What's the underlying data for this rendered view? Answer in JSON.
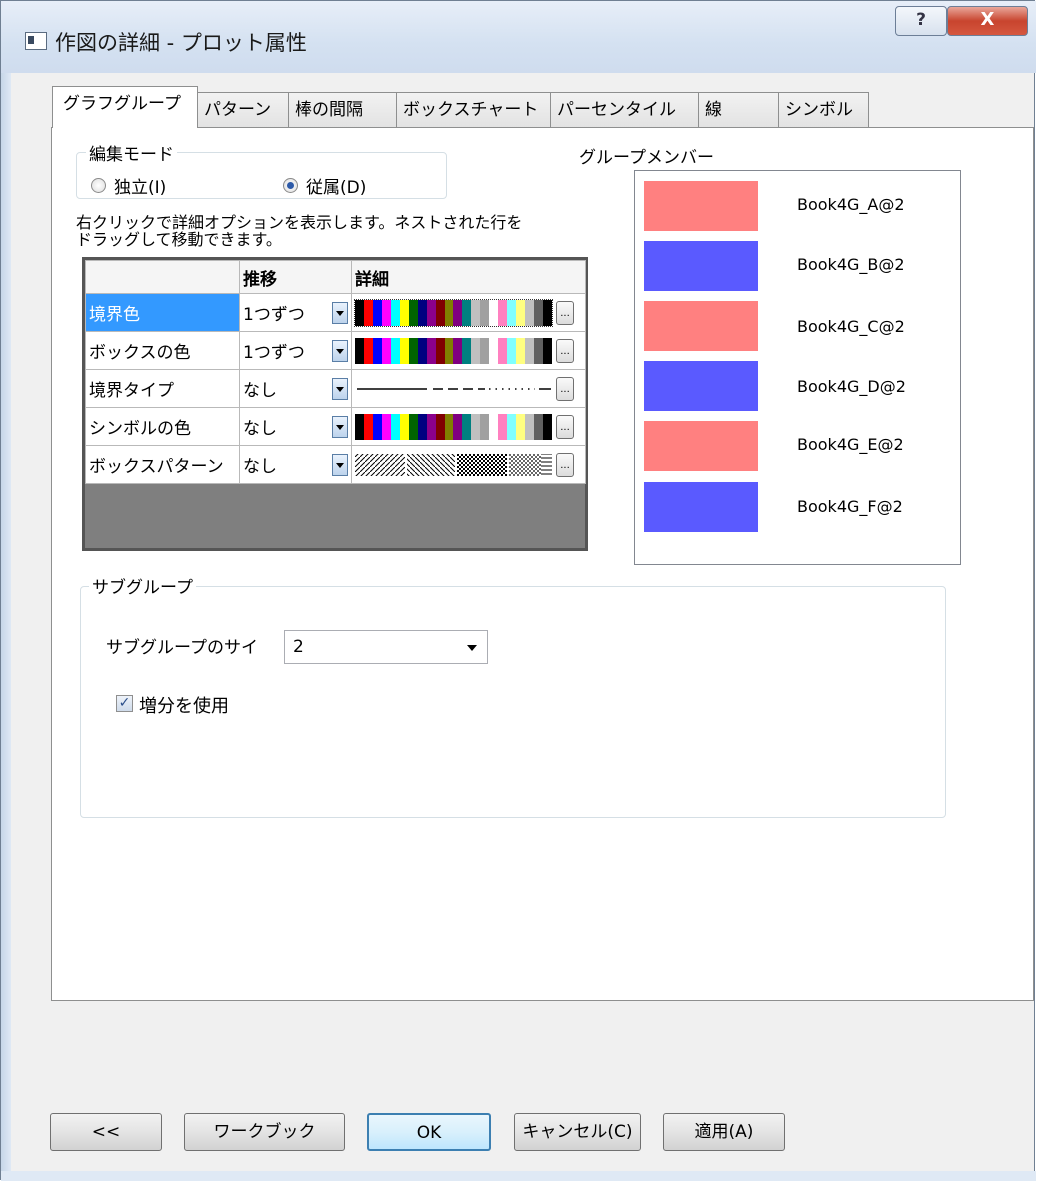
{
  "window": {
    "title": "作図の詳細 - プロット属性",
    "help_label": "?",
    "close_label": "X"
  },
  "tabs": [
    {
      "label": "グラフグループ",
      "active": true
    },
    {
      "label": "パターン",
      "active": false
    },
    {
      "label": "棒の間隔",
      "active": false
    },
    {
      "label": "ボックスチャート",
      "active": false
    },
    {
      "label": "パーセンタイル",
      "active": false
    },
    {
      "label": "線",
      "active": false
    },
    {
      "label": "シンボル",
      "active": false
    }
  ],
  "edit_mode": {
    "title": "編集モード",
    "independent_label": "独立(I)",
    "dependent_label": "従属(D)",
    "selected": "dependent"
  },
  "hint_text": "右クリックで詳細オプションを表示します。ネストされた行をドラッグして移動できます。",
  "grid": {
    "headers": [
      "",
      "推移",
      "詳細"
    ],
    "rows": [
      {
        "name": "境界色",
        "mode": "1つずつ",
        "detail": "colors",
        "selected": true
      },
      {
        "name": "ボックスの色",
        "mode": "1つずつ",
        "detail": "colors",
        "selected": false
      },
      {
        "name": "境界タイプ",
        "mode": "なし",
        "detail": "lines",
        "selected": false
      },
      {
        "name": "シンボルの色",
        "mode": "なし",
        "detail": "colors",
        "selected": false
      },
      {
        "name": "ボックスパターン",
        "mode": "なし",
        "detail": "patterns",
        "selected": false
      }
    ]
  },
  "color_strip": [
    "#000000",
    "#ff0000",
    "#0000ff",
    "#ff00ff",
    "#00ffff",
    "#ffff00",
    "#006400",
    "#000080",
    "#8b008b",
    "#800000",
    "#808000",
    "#800080",
    "#008080",
    "#c0c0c0",
    "#a0a0a0",
    "#ffffff",
    "#ff80c0",
    "#80ffff",
    "#ffff80",
    "#c0c0c0",
    "#606060",
    "#000000"
  ],
  "members": {
    "title": "グループメンバー",
    "items": [
      {
        "label": "Book4G_A@2",
        "color": "#ff8080"
      },
      {
        "label": "Book4G_B@2",
        "color": "#5a5aff"
      },
      {
        "label": "Book4G_C@2",
        "color": "#ff8080"
      },
      {
        "label": "Book4G_D@2",
        "color": "#5a5aff"
      },
      {
        "label": "Book4G_E@2",
        "color": "#ff8080"
      },
      {
        "label": "Book4G_F@2",
        "color": "#5a5aff"
      }
    ]
  },
  "subgroup": {
    "title": "サブグループ",
    "size_label": "サブグループのサイ",
    "size_value": "2",
    "use_increment_label": "増分を使用",
    "use_increment_checked": true
  },
  "buttons": {
    "back": "<<",
    "workbook": "ワークブック",
    "ok": "OK",
    "cancel": "キャンセル(C)",
    "apply": "適用(A)"
  }
}
